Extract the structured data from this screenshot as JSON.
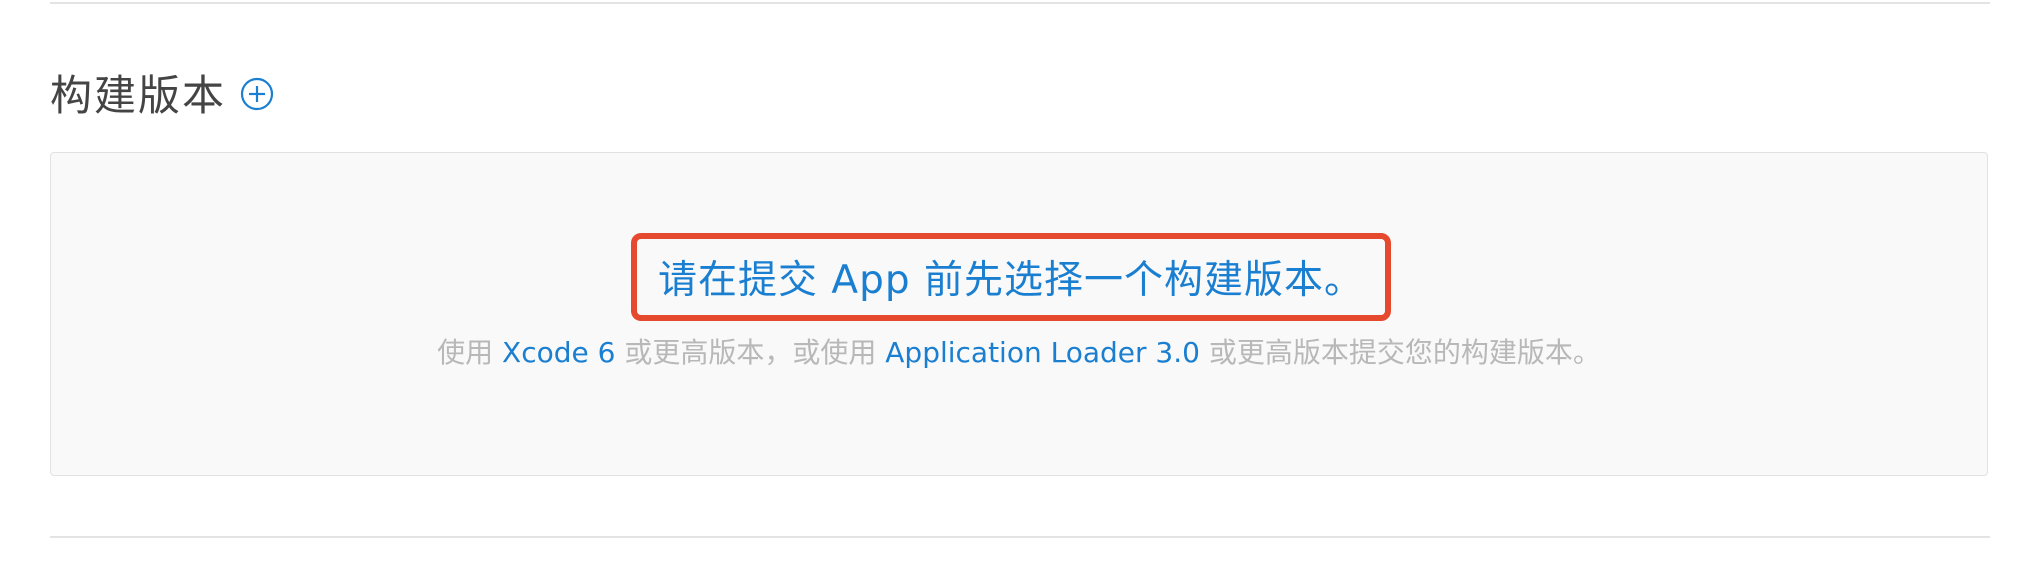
{
  "section": {
    "title": "构建版本",
    "add_icon": "plus-circle-icon"
  },
  "builds_panel": {
    "prompt": "请在提交 App 前先选择一个构建版本。",
    "help": {
      "part1": "使用 ",
      "link1": "Xcode 6",
      "part2": " 或更高版本，或使用 ",
      "link2": "Application Loader 3.0",
      "part3": " 或更高版本提交您的构建版本。"
    }
  },
  "colors": {
    "accent": "#1a7fd1",
    "highlight_border": "#e64a2e",
    "muted_text": "#b8b8b8",
    "title_text": "#444444"
  }
}
